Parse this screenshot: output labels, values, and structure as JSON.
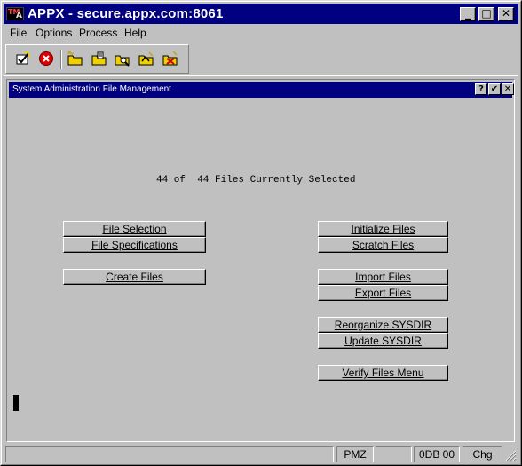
{
  "window": {
    "title": "APPX - secure.appx.com:8061",
    "logo_text_1": "TM",
    "logo_text_2": "A",
    "minimize_glyph": "_",
    "maximize_glyph": "□",
    "close_glyph": "✕"
  },
  "menu": {
    "file": "File",
    "options": "Options",
    "process": "Process",
    "help": "Help"
  },
  "toolbar": {
    "buttons": [
      {
        "name": "ok-icon"
      },
      {
        "name": "cancel-icon"
      },
      {
        "name": "new-folder-icon"
      },
      {
        "name": "open-folder-icon"
      },
      {
        "name": "search-folder-icon"
      },
      {
        "name": "folder-flag-icon"
      },
      {
        "name": "folder-delete-icon"
      }
    ]
  },
  "child_window": {
    "title": "System Administration File Management",
    "help_glyph": "?",
    "check_glyph": "✔",
    "close_glyph": "✕"
  },
  "status_message": "44 of  44 Files Currently Selected",
  "buttons": {
    "file_selection": "File Selection",
    "file_specifications": "File Specifications",
    "create_files": "Create Files",
    "initialize_files": "Initialize Files",
    "scratch_files": "Scratch Files",
    "import_files": "Import Files",
    "export_files": "Export Files",
    "reorganize_sysdir": "Reorganize SYSDIR",
    "update_sysdir": "Update SYSDIR",
    "verify_files_menu": "Verify Files Menu"
  },
  "statusbar": {
    "pane1": "",
    "pane2": "PMZ",
    "pane3": "",
    "pane4": "0DB 00",
    "pane5": "Chg"
  },
  "colors": {
    "titlebar": "#000080",
    "face": "#c0c0c0"
  }
}
